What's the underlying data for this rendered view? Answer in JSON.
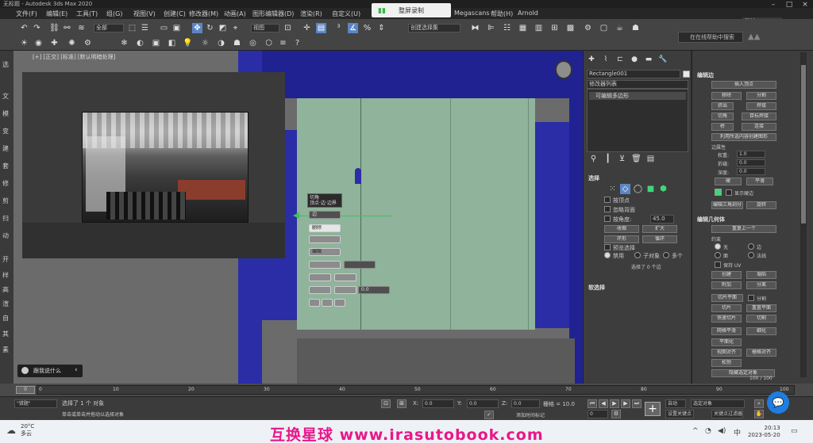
{
  "window": {
    "title": "无标题 - Autodesk 3ds Max 2020"
  },
  "menu": [
    "文件(F)",
    "编辑(E)",
    "工具(T)",
    "组(G)",
    "视图(V)",
    "创建(C)",
    "修改器(M)",
    "动画(A)",
    "图形编辑器(D)",
    "渲染(R)",
    "自定义(U)",
    "脚本(S)",
    "Megascans",
    "帮助(H)",
    "Arnold"
  ],
  "tray_popup": {
    "label": "整屏录制"
  },
  "header_right": {
    "tag": "默认"
  },
  "toolbar": {
    "undo_icon": "undo-icon",
    "selection_filter": "全部",
    "ref_coord": "视图",
    "named_selection": "创建选择集",
    "search_placeholder": "在在线帮助中搜索"
  },
  "sidebar": {
    "items": [
      "选",
      "文",
      "模",
      "变",
      "建",
      "套",
      "修",
      "剪",
      "扫",
      "动",
      "开",
      "样",
      "高",
      "渲",
      "自",
      "其",
      "素"
    ]
  },
  "viewport": {
    "label": "[+] [正交] [标准] [默认明暗处理]",
    "quad_tip": "切角\n顶点·边·边界",
    "quad_buttons": {
      "top": "边",
      "mid": "删除",
      "edit": "编辑",
      "value_label": "0.0"
    }
  },
  "chat": {
    "text": "跟我说什么"
  },
  "command_panel": {
    "object_name": "Rectangle001",
    "modifier_list": "修改器列表",
    "stack_item": "可编辑多边形",
    "selection_header": "选择",
    "selection_checks": [
      "按顶点",
      "忽略背面",
      "按角度:"
    ],
    "angle_value": "45.0",
    "buttons": [
      "收缩",
      "扩大",
      "环形",
      "循环"
    ],
    "preview_label": "预览选择",
    "preview_radios": [
      "禁用",
      "子对象",
      "多个"
    ],
    "selected_text": "选择了 0 个边",
    "soft_sel_header": "软选择"
  },
  "edit_poly": {
    "header": "编辑边",
    "insert_vertex": "插入顶点",
    "btn_rows": [
      [
        "移除",
        "分割"
      ],
      [
        "挤出",
        "焊接"
      ],
      [
        "切角",
        "目标焊接"
      ],
      [
        "桥",
        "连接"
      ]
    ],
    "create_shape": "利用所选内容创建图形",
    "weight_header": "边属性",
    "weight_label": "权重:",
    "weight_value": "1.0",
    "crease_label": "折缝:",
    "crease_value": "0.0",
    "depth_label": "深度:",
    "depth_value": "0.0",
    "hard_smooth": [
      "硬",
      "平滑"
    ],
    "display_hard": "显示硬边",
    "edit_tri": "编辑三角剖分",
    "turn": "旋转",
    "geom_header": "编辑几何体",
    "repeat_last": "重复上一个",
    "constraints_label": "约束",
    "constraint_radios": [
      "无",
      "边",
      "面",
      "法线"
    ],
    "preserve_uv": "保持 UV",
    "create": "创建",
    "collapse": "塌陷",
    "attach": "附加",
    "detach": "分离",
    "slice_plane": "切片平面",
    "split": "分割",
    "slice": "切片",
    "reset_plane": "重置平面",
    "quickslice": "快速切片",
    "cut": "切割",
    "meshsmooth": "网格平滑",
    "tessellate": "细化",
    "make_planar": "平面化",
    "view_align": "视图对齐",
    "grid_align": "栅格对齐",
    "relax": "松弛",
    "hide_sel": "隐藏选定对象",
    "page": "100 / 100"
  },
  "timeline": {
    "current": "0",
    "ticks": [
      "0",
      "10",
      "20",
      "30",
      "40",
      "50",
      "60",
      "70",
      "80",
      "90",
      "100"
    ]
  },
  "status": {
    "prompt_field": "\"错题\"",
    "selected": "选择了 1 个 对象",
    "hint": "单击或单击并拖动以选择对象",
    "x": "0.0",
    "y": "0.0",
    "z": "0.0",
    "grid": "栅格 = 10.0",
    "add_time_tag": "添加时间标记",
    "auto_key": "自动",
    "sel_set": "选定对象",
    "set_key": "设置关键点",
    "key_filters": "关键点过滤器...",
    "frame": "0"
  },
  "taskbar": {
    "weather_temp": "20°C",
    "weather_desc": "多云",
    "watermark": "互换星球 www.irasutobook.com",
    "time": "20:13",
    "date": "2023-05-20"
  }
}
